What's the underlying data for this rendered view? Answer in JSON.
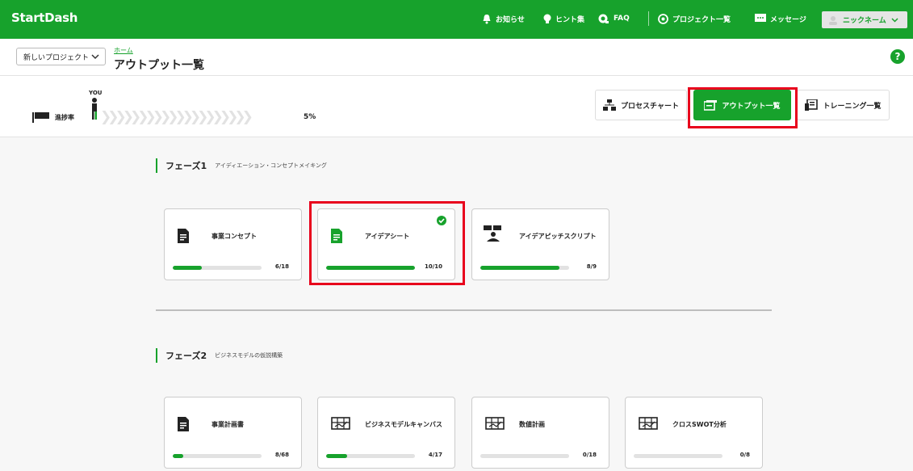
{
  "header": {
    "brand": "StartDash",
    "nav": [
      {
        "label": "お知らせ",
        "icon": "bell-icon"
      },
      {
        "label": "ヒント集",
        "icon": "lightbulb-icon"
      },
      {
        "label": "FAQ",
        "icon": "faq-icon"
      },
      {
        "label": "プロジェクト一覧",
        "icon": "project-list-icon"
      },
      {
        "label": "メッセージ",
        "icon": "message-icon"
      }
    ],
    "user": {
      "name": "ニックネーム",
      "icon": "user-avatar-icon"
    }
  },
  "subheader": {
    "project_select": "新しいプロジェクト",
    "breadcrumb": "ホーム",
    "title": "アウトプット一覧",
    "help": "?"
  },
  "progress": {
    "label": "進捗率",
    "you": "YOU",
    "percent_text": "5%",
    "percent": 5
  },
  "view_buttons": [
    {
      "label": "プロセスチャート",
      "icon": "process-chart-icon",
      "active": false
    },
    {
      "label": "アウトプット一覧",
      "icon": "output-list-icon",
      "active": true
    },
    {
      "label": "トレーニング一覧",
      "icon": "training-list-icon",
      "active": false
    }
  ],
  "phases": [
    {
      "name": "フェーズ1",
      "desc": "アイディエーション・コンセプトメイキング",
      "cards": [
        {
          "title": "事業コンセプト",
          "count": "6/18",
          "progress": 0.33,
          "icon": "document-icon",
          "done": false
        },
        {
          "title": "アイデアシート",
          "count": "10/10",
          "progress": 1.0,
          "icon": "document-icon",
          "done": true
        },
        {
          "title": "アイデアピッチスクリプト",
          "count": "8/9",
          "progress": 0.89,
          "icon": "pitch-icon",
          "done": false
        }
      ]
    },
    {
      "name": "フェーズ2",
      "desc": "ビジネスモデルの仮説構築",
      "cards": [
        {
          "title": "事業計画書",
          "count": "8/68",
          "progress": 0.12,
          "icon": "document-icon",
          "done": false
        },
        {
          "title": "ビジネスモデルキャンバス",
          "count": "4/17",
          "progress": 0.24,
          "icon": "canvas-icon",
          "done": false
        },
        {
          "title": "数値計画",
          "count": "0/18",
          "progress": 0,
          "icon": "canvas-icon",
          "done": false
        },
        {
          "title": "クロスSWOT分析",
          "count": "0/8",
          "progress": 0,
          "icon": "canvas-icon",
          "done": false
        }
      ]
    }
  ],
  "colors": {
    "brand": "#17a22c",
    "highlight": "#e8001c"
  }
}
